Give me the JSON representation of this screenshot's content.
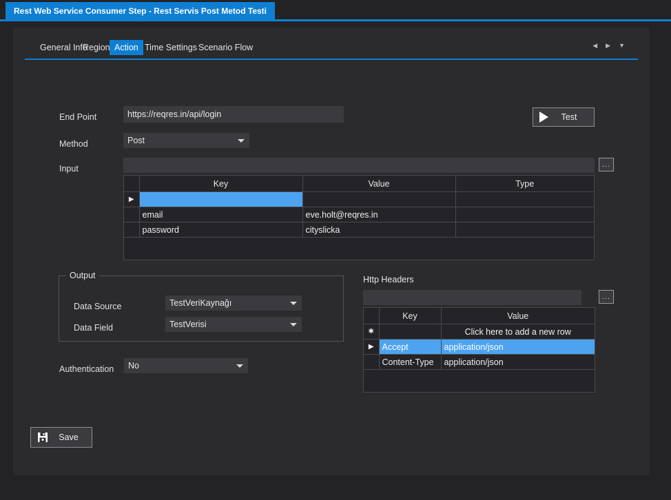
{
  "window": {
    "title": "Rest Web Service Consumer Step - Rest Servis Post Metod Testi"
  },
  "tabs": {
    "items": [
      {
        "label": "General Info",
        "active": false
      },
      {
        "label": "Region",
        "active": false
      },
      {
        "label": "Action",
        "active": true
      },
      {
        "label": "Time Settings",
        "active": false
      },
      {
        "label": "Scenario Flow",
        "active": false
      }
    ],
    "nav": {
      "prev_icon": "triangle-left-icon",
      "next_icon": "triangle-right-icon",
      "menu_icon": "chevron-down-icon"
    }
  },
  "form": {
    "endpoint": {
      "label": "End Point",
      "value": "https://reqres.in/api/login"
    },
    "method": {
      "label": "Method",
      "value": "Post"
    },
    "input": {
      "label": "Input",
      "value": "",
      "ellipsis_label": "..."
    },
    "authentication": {
      "label": "Authentication",
      "value": "No"
    }
  },
  "test_button": {
    "label": "Test",
    "icon": "play-icon"
  },
  "input_grid": {
    "columns": [
      "Key",
      "Value",
      "Type"
    ],
    "rows": [
      {
        "marker": "▶",
        "selected_cell": 0,
        "cells": [
          "",
          "",
          ""
        ]
      },
      {
        "marker": "",
        "selected_cell": -1,
        "cells": [
          "email",
          "eve.holt@reqres.in",
          ""
        ]
      },
      {
        "marker": "",
        "selected_cell": -1,
        "cells": [
          "password",
          "cityslicka",
          ""
        ]
      }
    ]
  },
  "output": {
    "title": "Output",
    "data_source": {
      "label": "Data Source",
      "value": "TestVeriKaynağı"
    },
    "data_field": {
      "label": "Data Field",
      "value": "TestVerisi"
    }
  },
  "http_headers": {
    "title": "Http Headers",
    "filter_value": "",
    "ellipsis_label": "...",
    "columns": [
      "Key",
      "Value"
    ],
    "new_row_text": "Click here to add a new row",
    "rows": [
      {
        "marker": "✱",
        "selected": false,
        "newrow": true,
        "cells": [
          "",
          "Click here to add a new row"
        ]
      },
      {
        "marker": "▶",
        "selected": true,
        "newrow": false,
        "cells": [
          "Accept",
          "application/json"
        ]
      },
      {
        "marker": "",
        "selected": false,
        "newrow": false,
        "cells": [
          "Content-Type",
          "application/json"
        ]
      }
    ]
  },
  "save_button": {
    "label": "Save",
    "icon": "floppy-disk-icon"
  },
  "colors": {
    "accent": "#0f7fd4",
    "selection": "#4da3f0",
    "panel": "#2b2b2e",
    "frame": "#232326",
    "field": "#3a3a3f"
  }
}
